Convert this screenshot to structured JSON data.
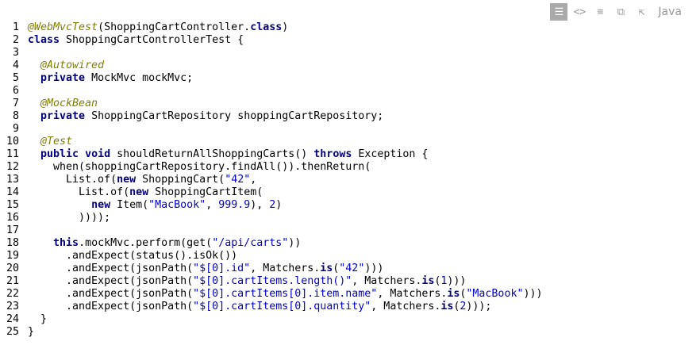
{
  "toolbar": {
    "icons": [
      "view-source-icon",
      "code-icon",
      "wrap-icon",
      "copy-icon",
      "popup-icon"
    ],
    "language": "Java"
  },
  "code": {
    "lines": [
      [
        [
          "ann",
          "@WebMvcTest"
        ],
        [
          "t",
          "(ShoppingCartController."
        ],
        [
          "kw",
          "class"
        ],
        [
          "t",
          ")"
        ]
      ],
      [
        [
          "kw",
          "class"
        ],
        [
          "t",
          " ShoppingCartControllerTest {"
        ]
      ],
      [],
      [
        [
          "t",
          "  "
        ],
        [
          "ann",
          "@Autowired"
        ]
      ],
      [
        [
          "t",
          "  "
        ],
        [
          "kw",
          "private"
        ],
        [
          "t",
          " MockMvc mockMvc;"
        ]
      ],
      [],
      [
        [
          "t",
          "  "
        ],
        [
          "ann",
          "@MockBean"
        ]
      ],
      [
        [
          "t",
          "  "
        ],
        [
          "kw",
          "private"
        ],
        [
          "t",
          " ShoppingCartRepository shoppingCartRepository;"
        ]
      ],
      [],
      [
        [
          "t",
          "  "
        ],
        [
          "ann",
          "@Test"
        ]
      ],
      [
        [
          "t",
          "  "
        ],
        [
          "kw",
          "public"
        ],
        [
          "t",
          " "
        ],
        [
          "kw",
          "void"
        ],
        [
          "t",
          " shouldReturnAllShoppingCarts() "
        ],
        [
          "kw",
          "throws"
        ],
        [
          "t",
          " Exception {"
        ]
      ],
      [
        [
          "t",
          "    when(shoppingCartRepository.findAll()).thenReturn("
        ]
      ],
      [
        [
          "t",
          "      List.of("
        ],
        [
          "kw",
          "new"
        ],
        [
          "t",
          " ShoppingCart("
        ],
        [
          "str",
          "\"42\""
        ],
        [
          "t",
          ","
        ]
      ],
      [
        [
          "t",
          "        List.of("
        ],
        [
          "kw",
          "new"
        ],
        [
          "t",
          " ShoppingCartItem("
        ]
      ],
      [
        [
          "t",
          "          "
        ],
        [
          "kw",
          "new"
        ],
        [
          "t",
          " Item("
        ],
        [
          "str",
          "\"MacBook\""
        ],
        [
          "t",
          ", "
        ],
        [
          "num",
          "999.9"
        ],
        [
          "t",
          "), "
        ],
        [
          "num",
          "2"
        ],
        [
          "t",
          ")"
        ]
      ],
      [
        [
          "t",
          "        ))));"
        ]
      ],
      [],
      [
        [
          "t",
          "    "
        ],
        [
          "kw",
          "this"
        ],
        [
          "t",
          ".mockMvc.perform(get("
        ],
        [
          "str",
          "\"/api/carts\""
        ],
        [
          "t",
          "))"
        ]
      ],
      [
        [
          "t",
          "      .andExpect(status().isOk())"
        ]
      ],
      [
        [
          "t",
          "      .andExpect(jsonPath("
        ],
        [
          "str",
          "\"$[0].id\""
        ],
        [
          "t",
          ", Matchers."
        ],
        [
          "kw",
          "is"
        ],
        [
          "t",
          "("
        ],
        [
          "str",
          "\"42\""
        ],
        [
          "t",
          ")))"
        ]
      ],
      [
        [
          "t",
          "      .andExpect(jsonPath("
        ],
        [
          "str",
          "\"$[0].cartItems.length()\""
        ],
        [
          "t",
          ", Matchers."
        ],
        [
          "kw",
          "is"
        ],
        [
          "t",
          "("
        ],
        [
          "num",
          "1"
        ],
        [
          "t",
          ")))"
        ]
      ],
      [
        [
          "t",
          "      .andExpect(jsonPath("
        ],
        [
          "str",
          "\"$[0].cartItems[0].item.name\""
        ],
        [
          "t",
          ", Matchers."
        ],
        [
          "kw",
          "is"
        ],
        [
          "t",
          "("
        ],
        [
          "str",
          "\"MacBook\""
        ],
        [
          "t",
          ")))"
        ]
      ],
      [
        [
          "t",
          "      .andExpect(jsonPath("
        ],
        [
          "str",
          "\"$[0].cartItems[0].quantity\""
        ],
        [
          "t",
          ", Matchers."
        ],
        [
          "kw",
          "is"
        ],
        [
          "t",
          "("
        ],
        [
          "num",
          "2"
        ],
        [
          "t",
          ")));"
        ]
      ],
      [
        [
          "t",
          "  }"
        ]
      ],
      [
        [
          "t",
          "}"
        ]
      ]
    ]
  }
}
